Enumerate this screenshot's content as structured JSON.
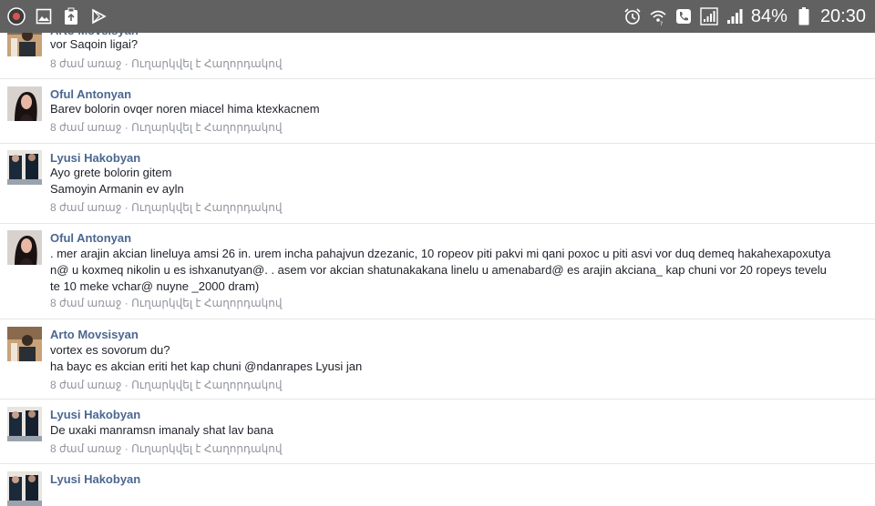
{
  "status_bar": {
    "battery_percent": "84%",
    "time": "20:30",
    "left_icons": [
      "app-circle-icon",
      "gallery-icon",
      "clipboard-update-icon",
      "play-store-icon"
    ],
    "right_icons": [
      "alarm-icon",
      "wifi-calling-icon",
      "phone-call-icon",
      "signal-box-icon",
      "cell-signal-icon",
      "battery-icon"
    ]
  },
  "comments": [
    {
      "author": "Arto Movsisyan",
      "lines": [
        "vor Saqoin ligai?"
      ],
      "time": "8 ժամ առաջ",
      "sent_via": "Ուղարկվել է Հաղորդակով",
      "avatar": "arto"
    },
    {
      "author": "Oful Antonyan",
      "lines": [
        "Barev bolorin ovqer noren miacel hima ktexkacnem"
      ],
      "time": "8 ժամ առաջ",
      "sent_via": "Ուղարկվել է Հաղորդակով",
      "avatar": "oful"
    },
    {
      "author": "Lyusi Hakobyan",
      "lines": [
        "Ayo grete bolorin gitem",
        "Samoyin Armanin ev ayln"
      ],
      "time": "8 ժամ առաջ",
      "sent_via": "Ուղարկվել է Հաղորդակով",
      "avatar": "lyusi"
    },
    {
      "author": "Oful Antonyan",
      "lines": [
        ". mer arajin akcian lineluya amsi 26 in. urem incha pahajvun dzezanic, 10 ropeov piti pakvi mi qani poxoc u piti asvi vor duq demeq hakahexapoxutya",
        "n@ u koxmeq nikolin u es ishxanutyan@. . asem vor akcian shatunakakana linelu u amenabard@ es arajin akciana_ kap chuni vor 20 ropeys tevelu",
        "te 10 meke vchar@ nuyne _2000 dram)"
      ],
      "time": "8 ժամ առաջ",
      "sent_via": "Ուղարկվել է Հաղորդակով",
      "avatar": "oful"
    },
    {
      "author": "Arto Movsisyan",
      "lines": [
        "vortex es sovorum du?",
        "ha bayc es akcian eriti het kap chuni @ndanrapes Lyusi jan"
      ],
      "time": "8 ժամ առաջ",
      "sent_via": "Ուղարկվել է Հաղորդակով",
      "avatar": "arto"
    },
    {
      "author": "Lyusi Hakobyan",
      "lines": [
        "De uxaki manramsn imanaly shat lav bana"
      ],
      "time": "8 ժամ առաջ",
      "sent_via": "Ուղարկվել է Հաղորդակով",
      "avatar": "lyusi"
    },
    {
      "author": "Lyusi Hakobyan",
      "lines": [],
      "time": "",
      "sent_via": "",
      "avatar": "lyusi"
    }
  ],
  "colors": {
    "status_bar_bg": "#616161",
    "author_name": "#4b6790",
    "message_text": "#1d2129",
    "meta_text": "#90949c"
  }
}
